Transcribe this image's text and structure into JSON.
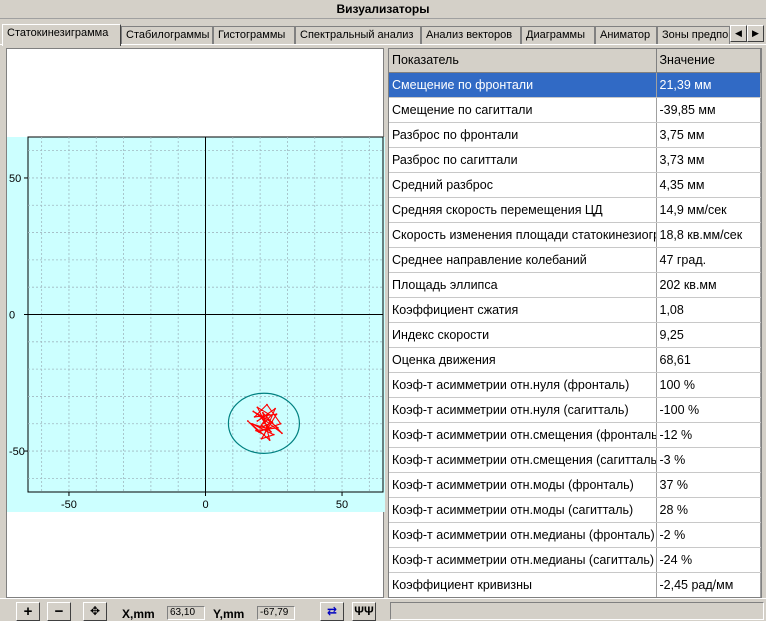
{
  "window": {
    "title": "Визуализаторы"
  },
  "tabs": [
    {
      "label": "Статокинезиграмма",
      "active": true
    },
    {
      "label": "Стабилограммы"
    },
    {
      "label": "Гистограммы"
    },
    {
      "label": "Спектральный анализ"
    },
    {
      "label": "Анализ векторов"
    },
    {
      "label": "Диаграммы"
    },
    {
      "label": "Аниматор"
    },
    {
      "label": "Зоны предпо"
    }
  ],
  "chart_data": {
    "type": "scatter",
    "title": "",
    "xlabel": "",
    "ylabel": "",
    "xlim": [
      -65,
      65
    ],
    "ylim": [
      -65,
      65
    ],
    "x_ticks": [
      "-50",
      "0",
      "50"
    ],
    "y_ticks": [
      "50",
      "0",
      "-50"
    ],
    "grid": true,
    "background_color": "#ccffff",
    "trace_color": "#ff0000",
    "ellipse_color": "#008080",
    "ellipse": {
      "center": [
        21.39,
        -39.85
      ],
      "rx": 13,
      "ry": 11
    },
    "series": [
      {
        "values": [
          [
            21.4,
            -39.9
          ],
          [
            24.0,
            -37.0
          ],
          [
            19.0,
            -34.0
          ],
          [
            23.0,
            -42.0
          ],
          [
            17.0,
            -40.0
          ],
          [
            25.0,
            -44.0
          ],
          [
            20.5,
            -45.5
          ],
          [
            26.0,
            -36.5
          ],
          [
            18.0,
            -37.5
          ],
          [
            22.5,
            -33.0
          ],
          [
            27.5,
            -40.0
          ],
          [
            19.5,
            -43.0
          ],
          [
            15.5,
            -39.0
          ],
          [
            23.5,
            -46.0
          ],
          [
            21.0,
            -36.0
          ],
          [
            28.0,
            -43.5
          ],
          [
            17.5,
            -35.5
          ],
          [
            24.5,
            -39.5
          ],
          [
            20.0,
            -41.5
          ],
          [
            22.0,
            -38.0
          ],
          [
            26.5,
            -41.5
          ],
          [
            18.5,
            -42.5
          ],
          [
            21.5,
            -44.0
          ],
          [
            25.5,
            -34.5
          ],
          [
            19.0,
            -39.0
          ],
          [
            23.0,
            -36.5
          ],
          [
            20.5,
            -40.5
          ],
          [
            24.0,
            -43.0
          ],
          [
            21.0,
            -38.5
          ],
          [
            22.8,
            -41.0
          ]
        ]
      }
    ]
  },
  "table": {
    "headers": [
      "Показатель",
      "Значение"
    ],
    "selected_row": 0,
    "rows": [
      [
        "Смещение по фронтали",
        "21,39 мм"
      ],
      [
        "Смещение по сагиттали",
        "-39,85 мм"
      ],
      [
        "Разброс по фронтали",
        "3,75 мм"
      ],
      [
        "Разброс по сагиттали",
        "3,73 мм"
      ],
      [
        "Средний разброс",
        "4,35 мм"
      ],
      [
        "Средняя скорость перемещения ЦД",
        "14,9 мм/сек"
      ],
      [
        "Скорость изменения площади статокинезиограммы",
        "18,8 кв.мм/сек"
      ],
      [
        "Среднее направление колебаний",
        "47 град."
      ],
      [
        "Площадь эллипса",
        "202 кв.мм"
      ],
      [
        "Коэффициент сжатия",
        "1,08"
      ],
      [
        "Индекс скорости",
        "9,25"
      ],
      [
        "Оценка движения",
        "68,61"
      ],
      [
        "Коэф-т асимметрии отн.нуля (фронталь)",
        "100 %"
      ],
      [
        "Коэф-т асимметрии отн.нуля (сагитталь)",
        "-100 %"
      ],
      [
        "Коэф-т асимметрии отн.смещения (фронталь)",
        "-12 %"
      ],
      [
        "Коэф-т асимметрии отн.смещения (сагитталь)",
        "-3 %"
      ],
      [
        "Коэф-т асимметрии отн.моды (фронталь)",
        "37 %"
      ],
      [
        "Коэф-т асимметрии отн.моды (сагитталь)",
        "28 %"
      ],
      [
        "Коэф-т асимметрии отн.медианы (фронталь)",
        "-2 %"
      ],
      [
        "Коэф-т асимметрии отн.медианы (сагитталь)",
        "-24 %"
      ],
      [
        "Коэффициент кривизны",
        "-2,45 рад/мм"
      ]
    ]
  },
  "statusbar": {
    "zoom_in": "+",
    "zoom_out": "−",
    "x_label": "X,mm",
    "x_value": "63,10",
    "y_label": "Y,mm",
    "y_value": "-67,79"
  }
}
